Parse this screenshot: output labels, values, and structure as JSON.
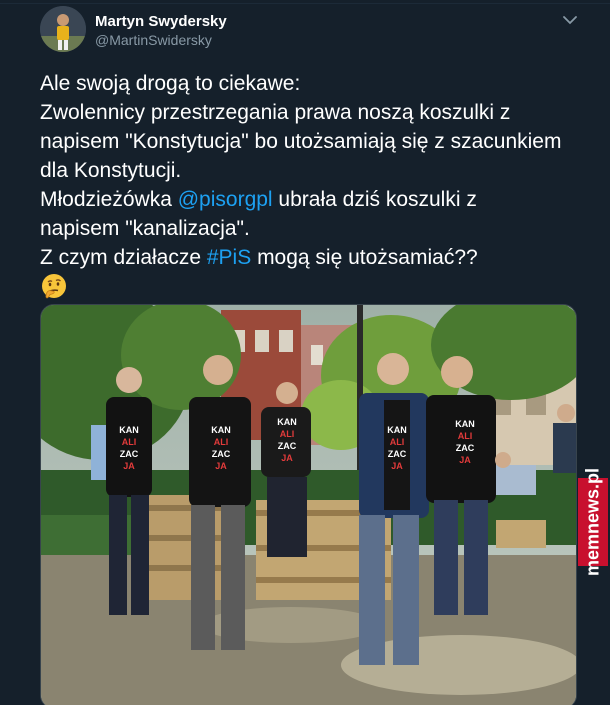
{
  "author": {
    "name": "Martyn Swydersky",
    "handle": "@MartinSwidersky"
  },
  "tweet": {
    "line1": "Ale swoją drogą to ciekawe:",
    "line2": "Zwolennicy przestrzegania prawa noszą koszulki z",
    "line3": "napisem \"Konstytucja\" bo utożsamiają się z szacunkiem",
    "line4": "dla Konstytucji.",
    "line5_before": "Młodzieżówka ",
    "line5_mention": "@pisorgpl",
    "line5_after": " ubrała dziś koszulki z",
    "line6": "napisem \"kanalizacja\".",
    "line7_before": "Z czym działacze ",
    "line7_hashtag": "#PiS",
    "line7_after": " mogą się utożsamiać??"
  },
  "photo": {
    "shirt_lines": [
      "KAN",
      "ALI",
      "ZAC",
      "JA"
    ]
  },
  "watermark": {
    "text": "memnews.pl"
  },
  "icons": {
    "menu": "chevron-down-icon",
    "emoji": "thinking-face-emoji"
  },
  "colors": {
    "background": "#15202b",
    "link": "#1da1f2",
    "secondary_text": "#8899a6",
    "watermark": "#c8102e"
  }
}
